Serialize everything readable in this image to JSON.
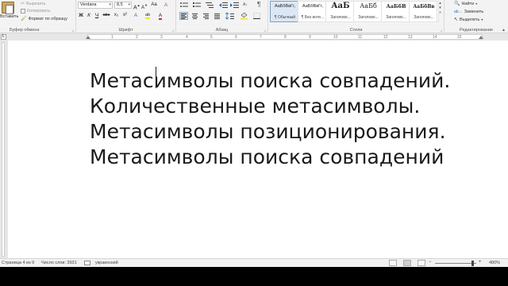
{
  "ribbon": {
    "clipboard": {
      "paste_label": "Вставить",
      "cut_label": "Вырезать",
      "copy_label": "Копировать",
      "format_painter_label": "Формат по образцу",
      "group_label": "Буфер обмена"
    },
    "font": {
      "font_name": "Verdana",
      "font_size": "8,5",
      "grow_label": "A",
      "shrink_label": "A",
      "case_label": "Aa",
      "clear_label": "A",
      "bold_label": "Ж",
      "italic_label": "К",
      "underline_label": "Ч",
      "strike_label": "abc",
      "subscript_label": "x₂",
      "superscript_label": "x²",
      "effects_label": "A",
      "highlight_label": "ab",
      "color_label": "A",
      "group_label": "Шрифт"
    },
    "paragraph": {
      "pilcrow_label": "¶",
      "group_label": "Абзац"
    },
    "styles": {
      "items": [
        {
          "sample": "АаБбВвГг,",
          "name": "¶ Обычный"
        },
        {
          "sample": "АаБбВвГг,",
          "name": "¶ Без инте..."
        },
        {
          "sample": "АаБ",
          "name": "Заголово..."
        },
        {
          "sample": "АаБб",
          "name": "Заголово..."
        },
        {
          "sample": "АаБбВ",
          "name": "Заголово..."
        },
        {
          "sample": "АаБбВв",
          "name": "Заголово..."
        }
      ],
      "group_label": "Стили"
    },
    "editing": {
      "find_label": "Найти",
      "replace_label": "Заменить",
      "select_label": "Выделить",
      "group_label": "Редактирование"
    }
  },
  "ruler": {
    "ticks": [
      "1",
      "2",
      "3",
      "4",
      "5",
      "6",
      "7",
      "8",
      "9",
      "10",
      "11",
      "12",
      "13",
      "14",
      "15"
    ]
  },
  "document": {
    "lines": [
      "Метасимволы поиска совпадений.",
      "Количественные метасимволы.",
      "Метасимволы позиционирования.",
      "Метасимволы поиска совпадений"
    ]
  },
  "status": {
    "page": "Страница 4 из 9",
    "words": "Число слов: 3931",
    "language": "украинский",
    "zoom": "480%"
  },
  "colors": {
    "ribbon_bg": "#f3f3f3",
    "workspace_bg": "#e6e6e6",
    "highlight_yellow": "#f6e03a",
    "font_color_red": "#d22a2a",
    "selected_style": "#dbe7f5"
  }
}
